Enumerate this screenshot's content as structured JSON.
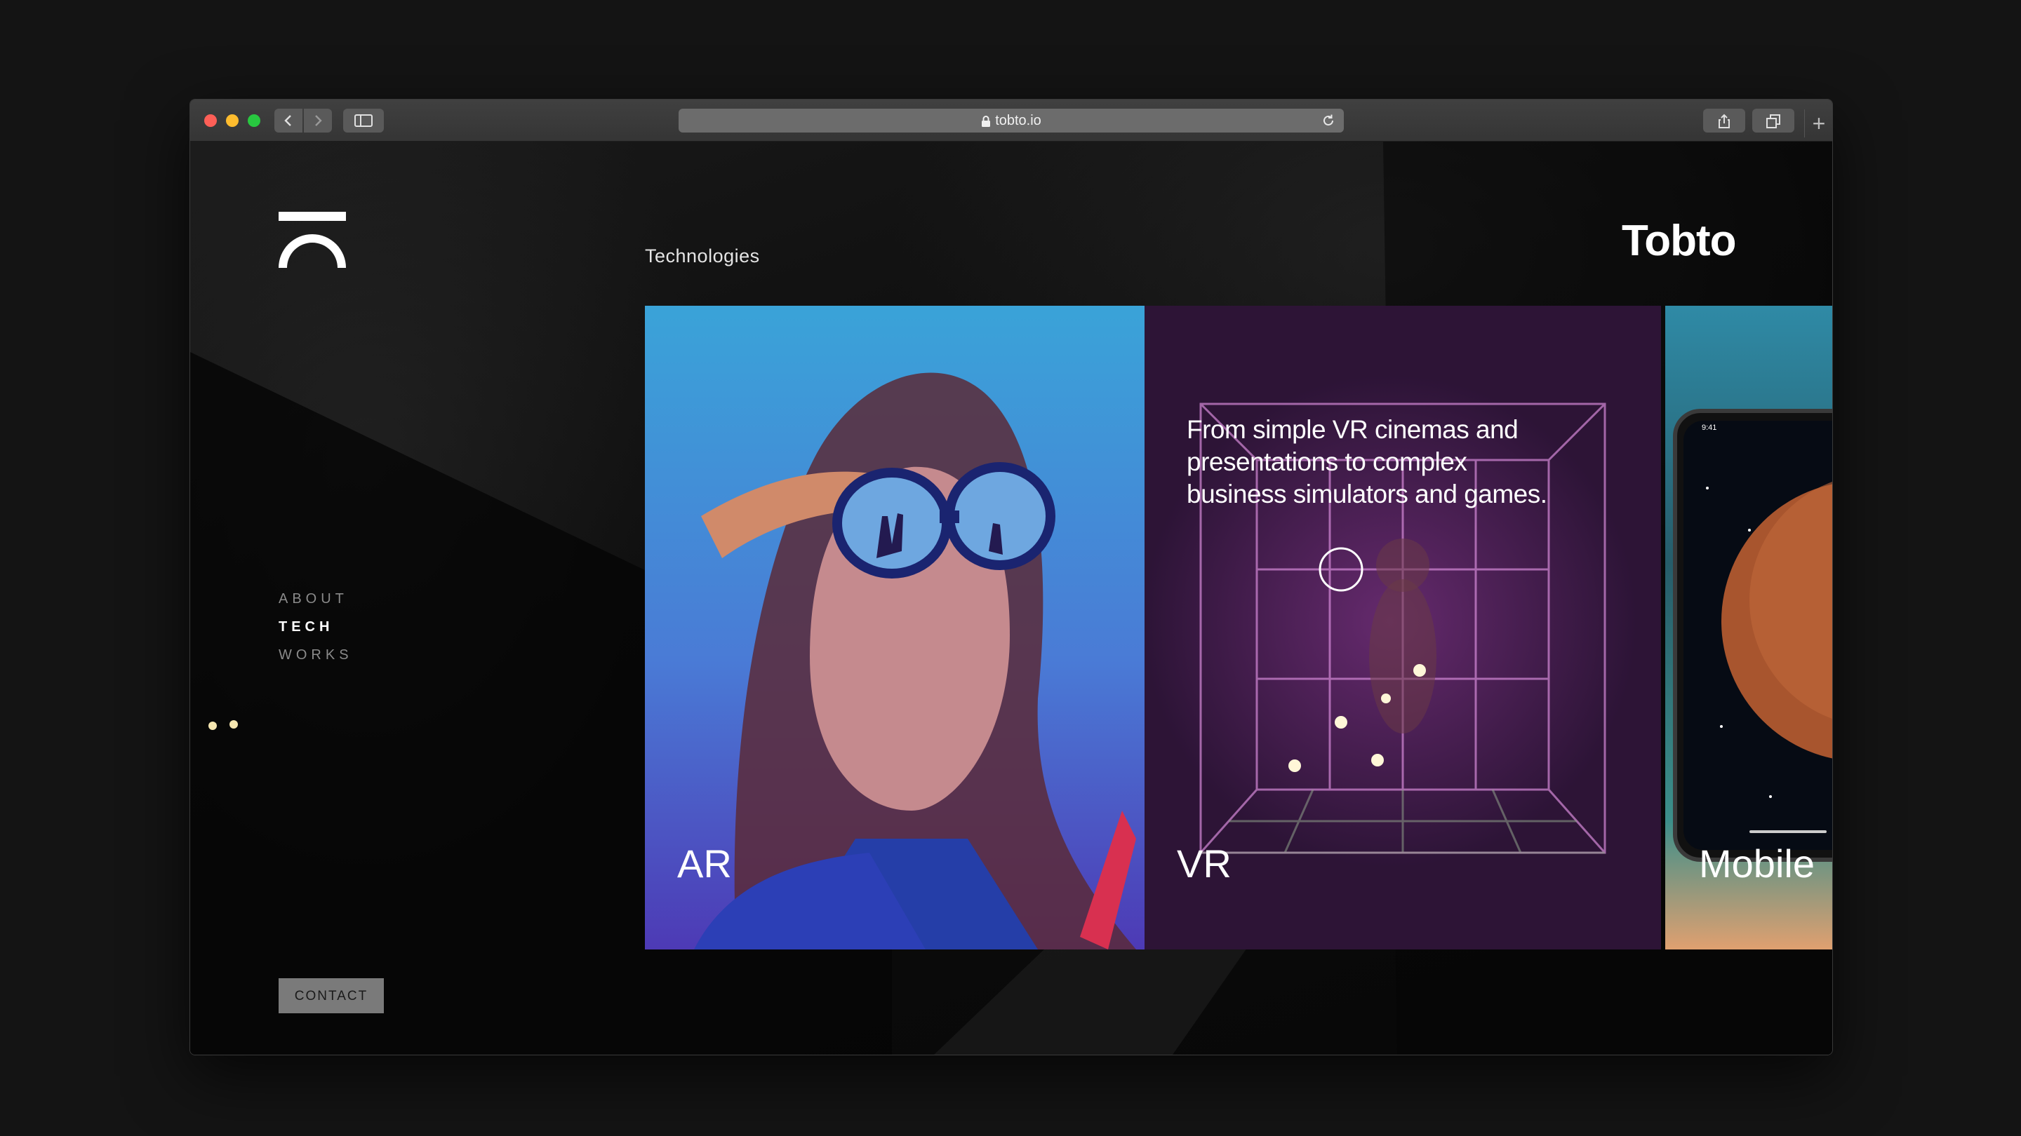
{
  "browser": {
    "url": "tobto.io"
  },
  "site": {
    "brand": "Tobto",
    "section_title": "Technologies",
    "nav": [
      {
        "label": "ABOUT",
        "active": false
      },
      {
        "label": "TECH",
        "active": true
      },
      {
        "label": "WORKS",
        "active": false
      }
    ],
    "contact_label": "CONTACT"
  },
  "cards": [
    {
      "label": "AR"
    },
    {
      "label": "VR",
      "description": "From simple VR cinemas and presentations to complex business simulators and games."
    },
    {
      "label": "Mobile"
    }
  ],
  "phone": {
    "status_time": "9:41"
  },
  "colors": {
    "background": "#0a0a0a",
    "ar_card": "#3aa3d8",
    "vr_card": "#2a1430",
    "contact_button": "#7a7a7a"
  }
}
